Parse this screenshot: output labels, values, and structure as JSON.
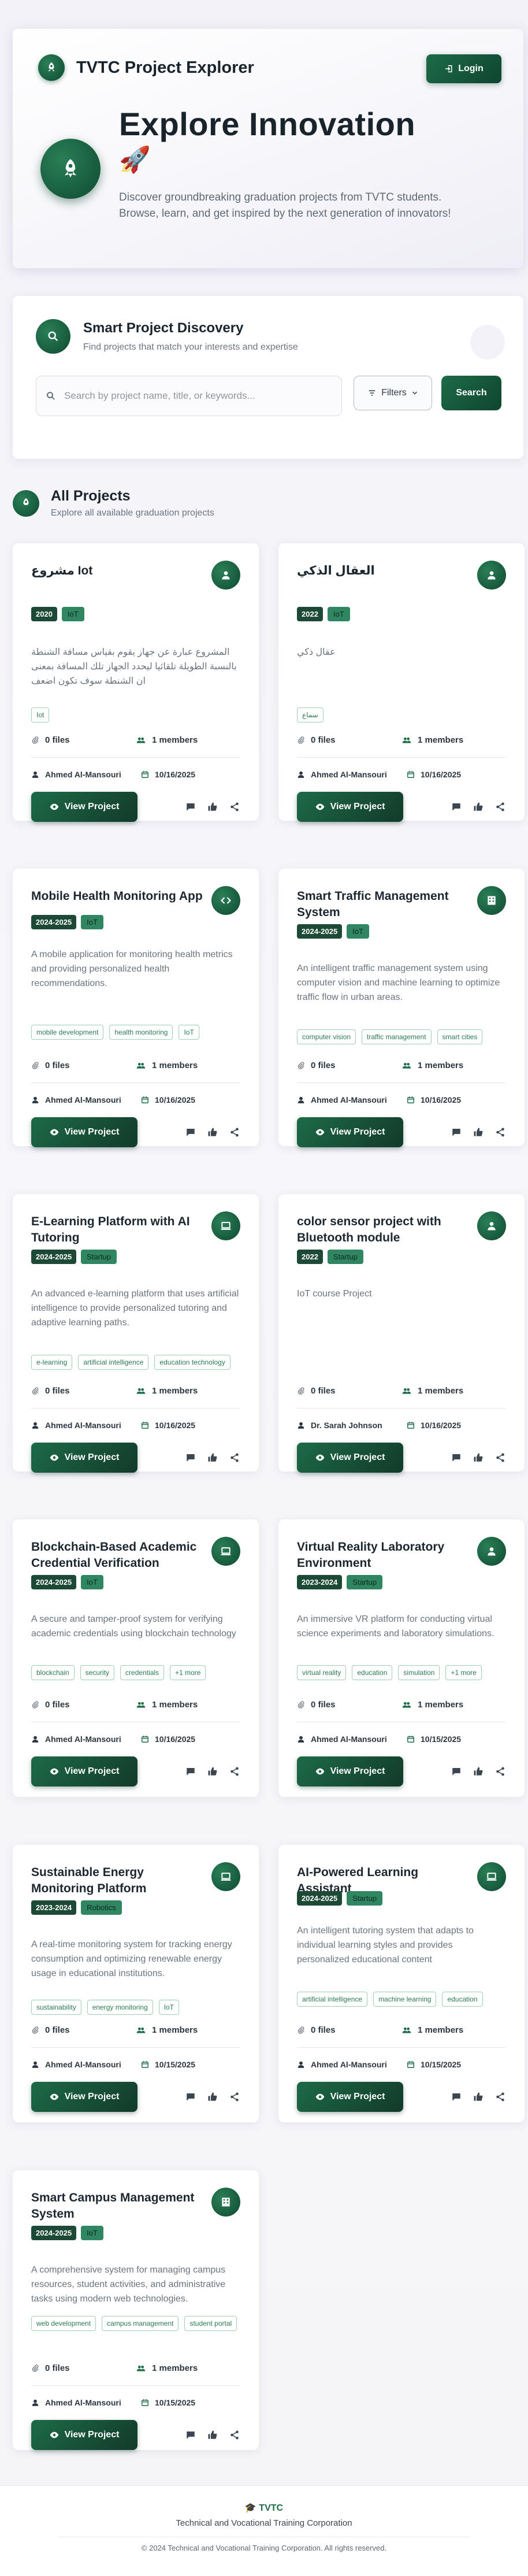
{
  "header": {
    "app_title": "TVTC Project Explorer",
    "login_label": "Login",
    "headline": "Explore Innovation",
    "rocket_emoji": "🚀",
    "description": "Discover groundbreaking graduation projects from TVTC students. Browse, learn, and get inspired by the next generation of innovators!"
  },
  "discovery": {
    "title": "Smart Project Discovery",
    "subtitle": "Find projects that match your interests and expertise",
    "search_placeholder": "Search by project name, title, or keywords...",
    "filters_label": "Filters",
    "search_label": "Search"
  },
  "projects_section": {
    "title": "All Projects",
    "subtitle": "Explore all available graduation projects"
  },
  "colors": {
    "accent": "#1d6b47",
    "accent_dark": "#0f4530",
    "tag_border": "#9fd0b6"
  },
  "cards": [
    {
      "title": "مشروع Iot",
      "icon": "user-icon",
      "year": "2020",
      "type": "IoT",
      "description": "المشروع عبارة عن جهاز يقوم بقياس مسافة الشنطة بالنسبة الطويلة تلقائيا ليحدد الجهاز تلك المسافة بمعنى ان الشنطة سوف تكون اضعف",
      "tags": [
        "Iot"
      ],
      "files": "0 files",
      "members": "1 members",
      "author": "Ahmed Al-Mansouri",
      "date": "10/16/2025",
      "view_label": "View Project"
    },
    {
      "title": "العقال الذكي",
      "icon": "user-icon",
      "year": "2022",
      "type": "IoT",
      "description": "عقال ذكي",
      "tags": [
        "سماع"
      ],
      "files": "0 files",
      "members": "1 members",
      "author": "Ahmed Al-Mansouri",
      "date": "10/16/2025",
      "view_label": "View Project"
    },
    {
      "title": "Mobile Health Monitoring App",
      "icon": "code-icon",
      "year": "2024-2025",
      "type": "IoT",
      "description": "A mobile application for monitoring health metrics and providing personalized health recommendations.",
      "tags": [
        "mobile development",
        "health monitoring",
        "IoT"
      ],
      "files": "0 files",
      "members": "1 members",
      "author": "Ahmed Al-Mansouri",
      "date": "10/16/2025",
      "view_label": "View Project"
    },
    {
      "title": "Smart Traffic Management System",
      "icon": "building-icon",
      "year": "2024-2025",
      "type": "IoT",
      "description": "An intelligent traffic management system using computer vision and machine learning to optimize traffic flow in urban areas.",
      "tags": [
        "computer vision",
        "traffic management",
        "smart cities"
      ],
      "files": "0 files",
      "members": "1 members",
      "author": "Ahmed Al-Mansouri",
      "date": "10/16/2025",
      "view_label": "View Project"
    },
    {
      "title": "E-Learning Platform with AI Tutoring",
      "icon": "laptop-icon",
      "year": "2024-2025",
      "type": "Startup",
      "description": "An advanced e-learning platform that uses artificial intelligence to provide personalized tutoring and adaptive learning paths.",
      "tags": [
        "e-learning",
        "artificial intelligence",
        "education technology"
      ],
      "files": "0 files",
      "members": "1 members",
      "author": "Ahmed Al-Mansouri",
      "date": "10/16/2025",
      "view_label": "View Project"
    },
    {
      "title": "color sensor project with Bluetooth module",
      "icon": "user-icon",
      "year": "2022",
      "type": "Startup",
      "description": "IoT course Project",
      "tags": [],
      "files": "0 files",
      "members": "1 members",
      "author": "Dr. Sarah Johnson",
      "date": "10/16/2025",
      "view_label": "View Project"
    },
    {
      "title": "Blockchain-Based Academic Credential Verification",
      "icon": "laptop-icon",
      "year": "2024-2025",
      "type": "IoT",
      "description": "A secure and tamper-proof system for verifying academic credentials using blockchain technology",
      "tags": [
        "blockchain",
        "security",
        "credentials",
        "+1 more"
      ],
      "files": "0 files",
      "members": "1 members",
      "author": "Ahmed Al-Mansouri",
      "date": "10/16/2025",
      "view_label": "View Project"
    },
    {
      "title": "Virtual Reality Laboratory Environment",
      "icon": "user-icon",
      "year": "2023-2024",
      "type": "Startup",
      "description": "An immersive VR platform for conducting virtual science experiments and laboratory simulations.",
      "tags": [
        "virtual reality",
        "education",
        "simulation",
        "+1 more"
      ],
      "files": "0 files",
      "members": "1 members",
      "author": "Ahmed Al-Mansouri",
      "date": "10/15/2025",
      "view_label": "View Project"
    },
    {
      "title": "Sustainable Energy Monitoring Platform",
      "icon": "laptop-icon",
      "year": "2023-2024",
      "type": "Robotics",
      "description": "A real-time monitoring system for tracking energy consumption and optimizing renewable energy usage in educational institutions.",
      "tags": [
        "sustainability",
        "energy monitoring",
        "IoT"
      ],
      "files": "0 files",
      "members": "1 members",
      "author": "Ahmed Al-Mansouri",
      "date": "10/15/2025",
      "view_label": "View Project"
    },
    {
      "title": "AI-Powered Learning Assistant",
      "icon": "laptop-icon",
      "year": "2024-2025",
      "type": "Startup",
      "description": "An intelligent tutoring system that adapts to individual learning styles and provides personalized educational content",
      "tags": [
        "artificial intelligence",
        "machine learning",
        "education"
      ],
      "files": "0 files",
      "members": "1 members",
      "author": "Ahmed Al-Mansouri",
      "date": "10/15/2025",
      "view_label": "View Project"
    },
    {
      "title": "Smart Campus Management System",
      "icon": "building-icon",
      "year": "2024-2025",
      "type": "IoT",
      "description": "A comprehensive system for managing campus resources, student activities, and administrative tasks using modern web technologies.",
      "tags": [
        "web development",
        "campus management",
        "student portal"
      ],
      "files": "0 files",
      "members": "1 members",
      "author": "Ahmed Al-Mansouri",
      "date": "10/15/2025",
      "view_label": "View Project"
    }
  ],
  "footer": {
    "brand": "TVTC",
    "organization": "Technical and Vocational Training Corporation",
    "copyright": "© 2024 Technical and Vocational Training Corporation. All rights reserved."
  }
}
